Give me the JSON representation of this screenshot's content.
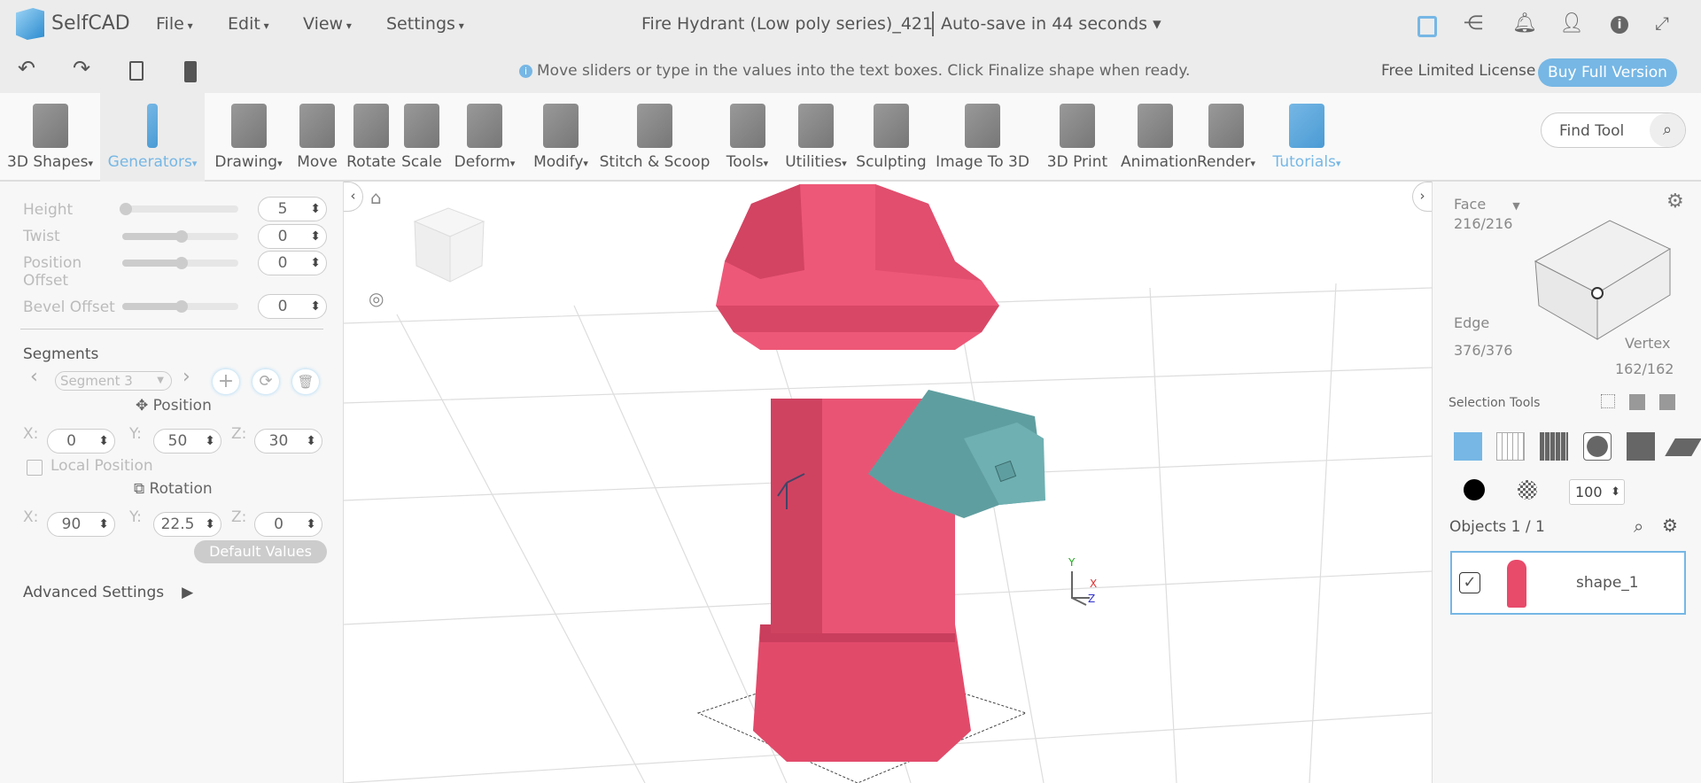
{
  "app": {
    "name": "SelfCAD",
    "menus": [
      "File",
      "Edit",
      "View",
      "Settings"
    ],
    "doc_title": "Fire Hydrant (Low poly series)_421",
    "autosave": "Auto-save in 44 seconds"
  },
  "subbar": {
    "hint": "Move sliders or type in the values into the text boxes. Click Finalize shape when ready.",
    "license": "Free Limited License",
    "buy": "Buy Full Version"
  },
  "toolbar": {
    "items": [
      {
        "label": "3D Shapes",
        "dd": true
      },
      {
        "label": "Generators",
        "dd": true,
        "active": true
      },
      {
        "label": "Drawing",
        "dd": true
      },
      {
        "label": "Move"
      },
      {
        "label": "Rotate"
      },
      {
        "label": "Scale"
      },
      {
        "label": "Deform",
        "dd": true
      },
      {
        "label": "Modify",
        "dd": true
      },
      {
        "label": "Stitch & Scoop"
      },
      {
        "label": "Tools",
        "dd": true
      },
      {
        "label": "Utilities",
        "dd": true
      },
      {
        "label": "Sculpting"
      },
      {
        "label": "Image To 3D"
      },
      {
        "label": "3D Print"
      },
      {
        "label": "Animation"
      },
      {
        "label": "Render",
        "dd": true
      },
      {
        "label": "Tutorials",
        "dd": true
      }
    ],
    "find_tool": "Find Tool"
  },
  "left": {
    "height": {
      "label": "Height",
      "value": "5",
      "fraction": 0.0
    },
    "twist": {
      "label": "Twist",
      "value": "0",
      "fraction": 0.5
    },
    "position_offset": {
      "label": "Position Offset",
      "value": "0",
      "fraction": 0.5
    },
    "bevel_offset": {
      "label": "Bevel Offset",
      "value": "0",
      "fraction": 0.5
    },
    "segments": "Segments",
    "segment_select": "Segment 3",
    "position": "Position",
    "pos": {
      "x": "0",
      "y": "50",
      "z": "30"
    },
    "local_position": "Local Position",
    "rotation": "Rotation",
    "rot": {
      "x": "90",
      "y": "22.5",
      "z": "0"
    },
    "axis": {
      "x": "X:",
      "y": "Y:",
      "z": "Z:"
    },
    "default_values": "Default Values",
    "advanced": "Advanced Settings"
  },
  "right": {
    "face": "Face",
    "face_count": "216/216",
    "edge": "Edge",
    "edge_count": "376/376",
    "vertex": "Vertex",
    "vertex_count": "162/162",
    "selection_tools": "Selection Tools",
    "opacity": "100",
    "objects": "Objects 1 / 1",
    "object_name": "shape_1"
  },
  "colors": {
    "accent": "#76b7e5",
    "hydrant": "#e84a6a",
    "nozzle": "#5f9ea0"
  }
}
